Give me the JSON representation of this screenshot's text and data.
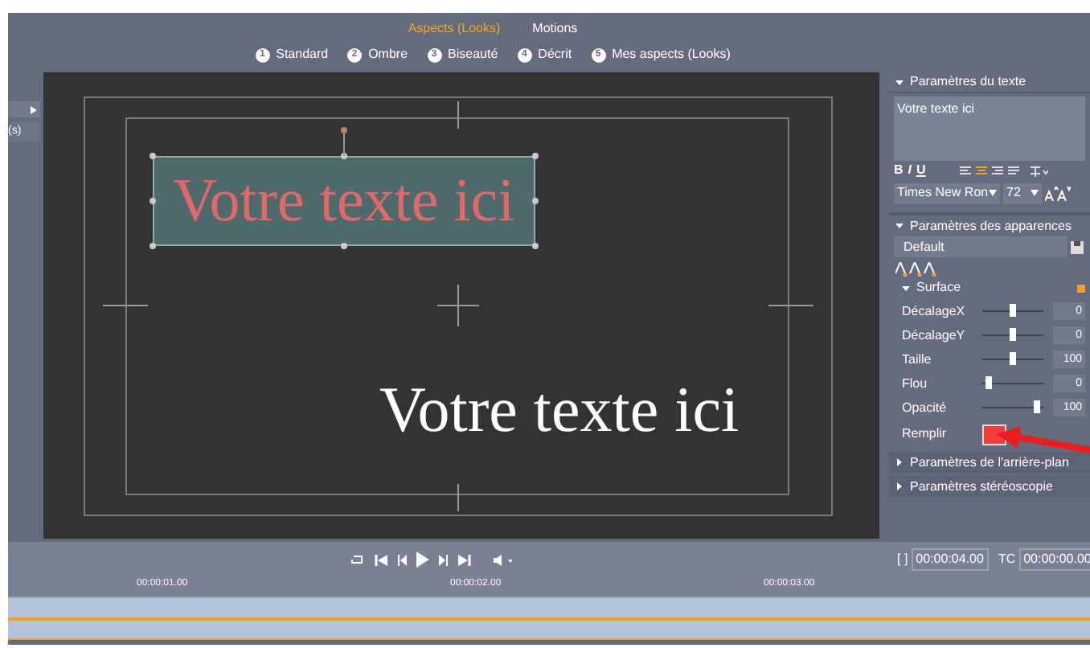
{
  "top_tabs": [
    {
      "label": "Aspects (Looks)",
      "selected": true
    },
    {
      "label": "Motions",
      "selected": false
    }
  ],
  "look_tabs": [
    {
      "number": "1",
      "label": "Standard"
    },
    {
      "number": "2",
      "label": "Ombre"
    },
    {
      "number": "3",
      "label": "Biseauté"
    },
    {
      "number": "4",
      "label": "Décrit"
    },
    {
      "number": "5",
      "label": "Mes aspects (Looks)"
    }
  ],
  "left_panel": {
    "item": "(s)"
  },
  "canvas": {
    "selected_text": "Votre texte ici",
    "text": "Votre texte ici"
  },
  "text_settings": {
    "title": "Paramètres du texte",
    "expanded": true,
    "value": "Votre texte ici",
    "format_buttons": [
      "B",
      "I",
      "U"
    ],
    "font": "Times New Ron",
    "size": "72"
  },
  "appearance_settings": {
    "title": "Paramètres des apparences",
    "expanded": true,
    "preset": "Default",
    "surface": {
      "title": "Surface",
      "expanded": true,
      "sliders": [
        {
          "label": "DécalageX",
          "level": 0.5,
          "value": "0"
        },
        {
          "label": "DécalageY",
          "level": 0.5,
          "value": "0"
        },
        {
          "label": "Taille",
          "level": 0.5,
          "value": "100"
        },
        {
          "label": "Flou",
          "level": 0.05,
          "value": "0"
        },
        {
          "label": "Opacité",
          "level": 0.95,
          "value": "100"
        }
      ],
      "fill_label": "Remplir"
    }
  },
  "collapsed_sections": [
    {
      "title": "Paramètres de l'arrière-plan",
      "expanded": false
    },
    {
      "title": "Paramètres stéréoscopie",
      "expanded": false
    }
  ],
  "transport": {
    "duration_label": "[ ]",
    "duration": "00:00:04.00",
    "tc_label": "TC",
    "timecode": "00:00:00.00"
  },
  "ruler": [
    "00:00:01.00",
    "00:00:02.00",
    "00:00:03.00"
  ]
}
